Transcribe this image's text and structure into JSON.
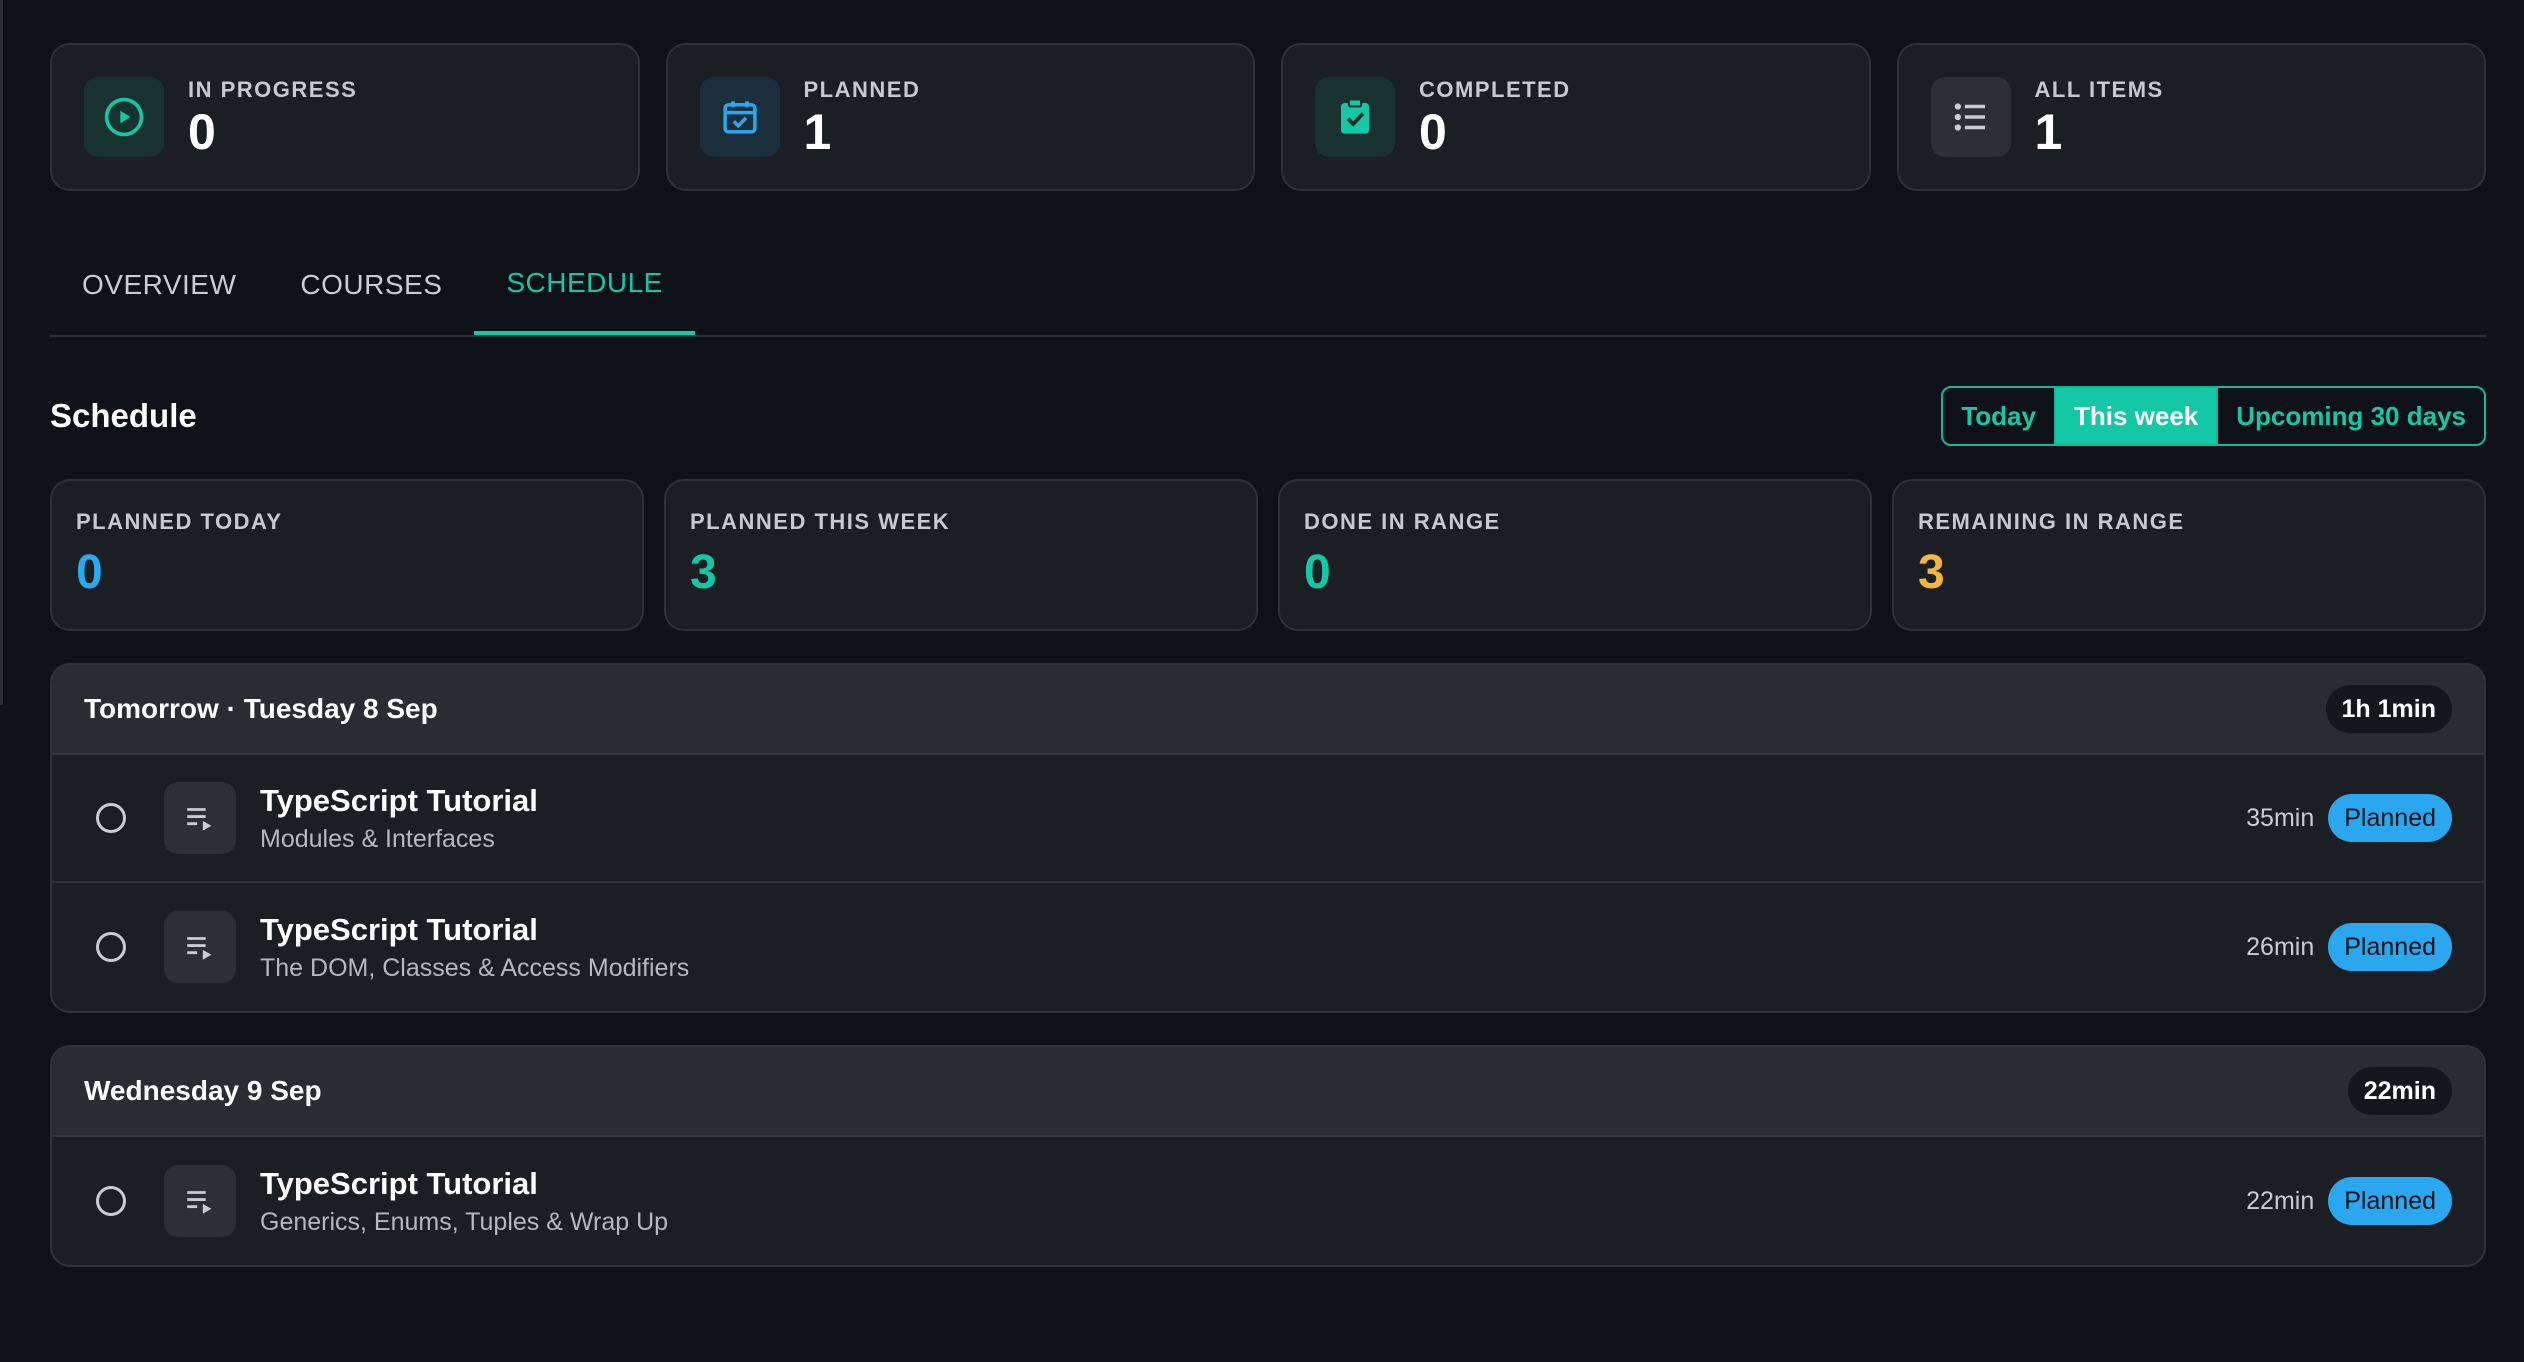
{
  "stats": [
    {
      "label": "IN PROGRESS",
      "value": "0",
      "icon": "play-circle-icon"
    },
    {
      "label": "PLANNED",
      "value": "1",
      "icon": "calendar-check-icon"
    },
    {
      "label": "COMPLETED",
      "value": "0",
      "icon": "clipboard-check-icon"
    },
    {
      "label": "ALL ITEMS",
      "value": "1",
      "icon": "list-icon"
    }
  ],
  "tabs": [
    {
      "label": "OVERVIEW",
      "active": false
    },
    {
      "label": "COURSES",
      "active": false
    },
    {
      "label": "SCHEDULE",
      "active": true
    }
  ],
  "schedule": {
    "title": "Schedule",
    "ranges": [
      {
        "label": "Today",
        "active": false
      },
      {
        "label": "This week",
        "active": true
      },
      {
        "label": "Upcoming 30 days",
        "active": false
      }
    ],
    "summary": [
      {
        "label": "PLANNED TODAY",
        "value": "0",
        "color": "#2aa7ef"
      },
      {
        "label": "PLANNED THIS WEEK",
        "value": "3",
        "color": "#14c8a6"
      },
      {
        "label": "DONE IN RANGE",
        "value": "0",
        "color": "#14c8a6"
      },
      {
        "label": "REMAINING IN RANGE",
        "value": "3",
        "color": "#f5b83d"
      }
    ],
    "days": [
      {
        "title": "Tomorrow · Tuesday 8 Sep",
        "duration": "1h 1min",
        "items": [
          {
            "title": "TypeScript Tutorial",
            "subtitle": "Modules & Interfaces",
            "duration": "35min",
            "status": "Planned"
          },
          {
            "title": "TypeScript Tutorial",
            "subtitle": "The DOM, Classes & Access Modifiers",
            "duration": "26min",
            "status": "Planned"
          }
        ]
      },
      {
        "title": "Wednesday 9 Sep",
        "duration": "22min",
        "items": [
          {
            "title": "TypeScript Tutorial",
            "subtitle": "Generics, Enums, Tuples & Wrap Up",
            "duration": "22min",
            "status": "Planned"
          }
        ]
      }
    ]
  },
  "colors": {
    "accent": "#14c8a6",
    "planned": "#2aa7ef",
    "remaining": "#f5b83d",
    "background": "#0e1117"
  }
}
